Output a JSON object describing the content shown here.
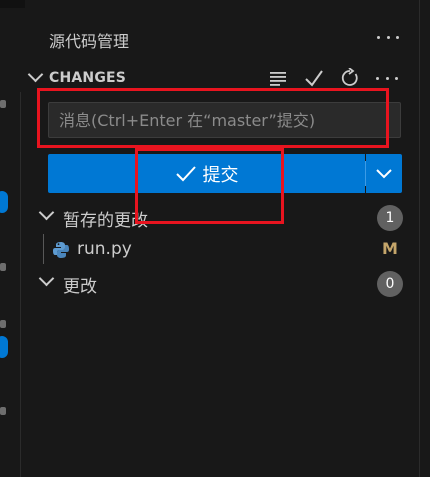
{
  "sidebar": {
    "title": "源代码管理"
  },
  "changes_section": {
    "label": "CHANGES",
    "icons": [
      "list-icon",
      "check-icon",
      "refresh-icon",
      "more-icon"
    ]
  },
  "commit": {
    "message_placeholder": "消息(Ctrl+Enter 在“master”提交)",
    "button_label": "提交"
  },
  "groups": [
    {
      "label": "暂存的更改",
      "count": "1",
      "files": [
        {
          "name": "run.py",
          "status": "M",
          "icon": "python-icon"
        }
      ]
    },
    {
      "label": "更改",
      "count": "0",
      "files": []
    }
  ],
  "colors": {
    "accent": "#0078d4",
    "modified": "#c4a56a",
    "annotation": "#e8141f",
    "background": "#181818"
  }
}
